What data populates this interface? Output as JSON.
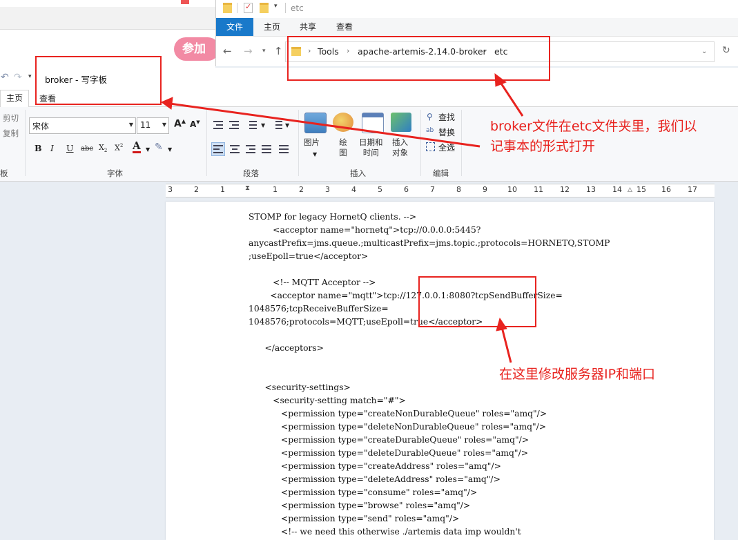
{
  "browser": {
    "join_button_label": "参加"
  },
  "explorer": {
    "title": "etc",
    "tabs": [
      "文件",
      "主页",
      "共享",
      "查看"
    ],
    "breadcrumb": [
      "Tools",
      "apache-artemis-2.14.0-broker",
      "etc"
    ],
    "sep": "›",
    "nav_icons": [
      "back-arrow-icon",
      "forward-arrow-icon",
      "recent-dropdown-icon",
      "up-arrow-icon",
      "refresh-icon"
    ]
  },
  "wordpad": {
    "title": "broker - 写字板",
    "tabs": {
      "home": "主页",
      "view": "查看"
    },
    "clipboard": {
      "cut": "剪切",
      "copy": "复制",
      "label_fragment": "板"
    },
    "font": {
      "family": "宋体",
      "size": "11",
      "group_label": "字体"
    },
    "paragraph": {
      "group_label": "段落"
    },
    "insert": {
      "picture": "图片",
      "paint": "绘\n图",
      "datetime": "日期和\n时间",
      "object": "插入\n对象",
      "group_label": "插入"
    },
    "editing": {
      "find": "查找",
      "replace": "替换",
      "select_all": "全选",
      "group_label": "编辑"
    },
    "ruler_numbers": [
      "3",
      "2",
      "1",
      "1",
      "2",
      "3",
      "4",
      "5",
      "6",
      "7",
      "8",
      "9",
      "10",
      "11",
      "12",
      "13",
      "14",
      "15",
      "16",
      "17"
    ]
  },
  "document_lines": [
    "STOMP for legacy HornetQ clients. -->",
    "         <acceptor name=\"hornetq\">tcp://0.0.0.0:5445?",
    "anycastPrefix=jms.queue.;multicastPrefix=jms.topic.;protocols=HORNETQ,STOMP",
    ";useEpoll=true</acceptor>",
    "",
    "         <!-- MQTT Acceptor -->",
    "        <acceptor name=\"mqtt\">tcp://127.0.0.1:8080?tcpSendBufferSize=",
    "1048576;tcpReceiveBufferSize=",
    "1048576;protocols=MQTT;useEpoll=true</acceptor>",
    "",
    "      </acceptors>",
    "",
    "",
    "      <security-settings>",
    "         <security-setting match=\"#\">",
    "            <permission type=\"createNonDurableQueue\" roles=\"amq\"/>",
    "            <permission type=\"deleteNonDurableQueue\" roles=\"amq\"/>",
    "            <permission type=\"createDurableQueue\" roles=\"amq\"/>",
    "            <permission type=\"deleteDurableQueue\" roles=\"amq\"/>",
    "            <permission type=\"createAddress\" roles=\"amq\"/>",
    "            <permission type=\"deleteAddress\" roles=\"amq\"/>",
    "            <permission type=\"consume\" roles=\"amq\"/>",
    "            <permission type=\"browse\" roles=\"amq\"/>",
    "            <permission type=\"send\" roles=\"amq\"/>",
    "            <!-- we need this otherwise ./artemis data imp wouldn't"
  ],
  "annotations": {
    "broker_note": "broker文件在etc文件夹里，我们以\n记事本的形式打开",
    "ip_note": "在这里修改服务器IP和端口"
  },
  "colors": {
    "annotation": "#e8231f",
    "file_tab": "#1979ca"
  }
}
